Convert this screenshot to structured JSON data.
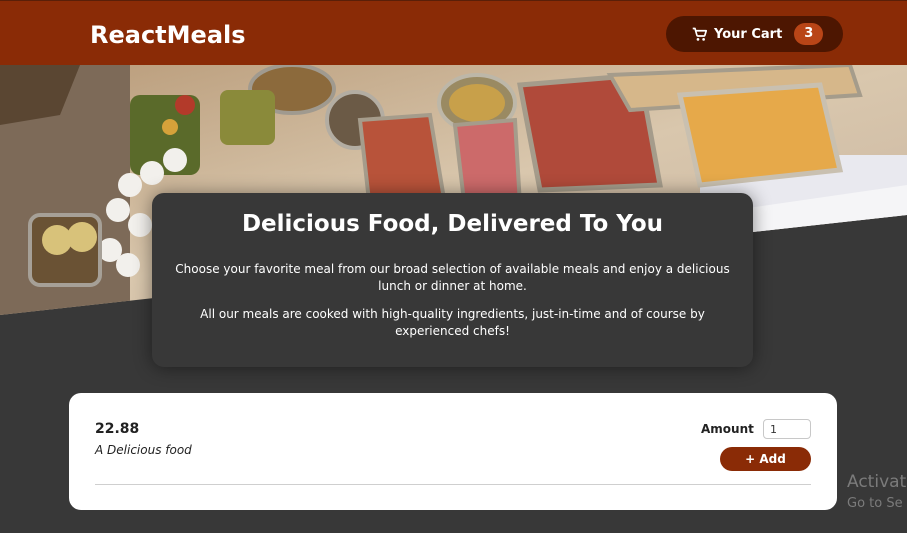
{
  "header": {
    "brand": "ReactMeals",
    "cart": {
      "label": "Your Cart",
      "count": "3",
      "icon": "cart-icon"
    }
  },
  "summary": {
    "title": "Delicious Food, Delivered To You",
    "paragraphs": [
      "Choose your favorite meal from our broad selection of available meals and enjoy a delicious lunch or dinner at home.",
      "All our meals are cooked with high-quality ingredients, just-in-time and of course by experienced chefs!"
    ]
  },
  "meals": [
    {
      "price": "22.88",
      "description": "A Delicious food",
      "amount_label": "Amount",
      "amount_value": "1",
      "add_label": "+ Add"
    }
  ],
  "watermark": {
    "line1": "Activat",
    "line2": "Go to Se"
  },
  "colors": {
    "header": "#8a2b06",
    "cart_button": "#4d1601",
    "cart_badge": "#b94517",
    "page_bg": "#383838",
    "add_button": "#8a2b06"
  }
}
